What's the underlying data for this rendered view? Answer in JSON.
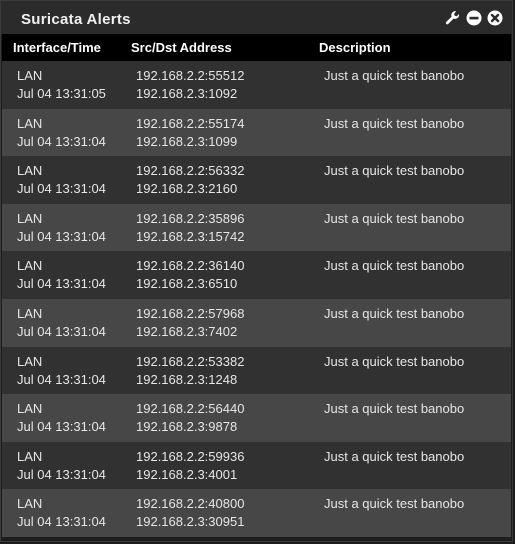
{
  "panel": {
    "title": "Suricata Alerts",
    "controls": [
      "wrench-icon",
      "minimize-icon",
      "close-icon"
    ]
  },
  "table": {
    "headers": [
      "Interface/Time",
      "Src/Dst Address",
      "Description"
    ],
    "rows": [
      {
        "iface": "LAN",
        "time": "Jul 04 13:31:05",
        "src": "192.168.2.2:55512",
        "dst": "192.168.2.3:1092",
        "desc": "Just a quick test banobo"
      },
      {
        "iface": "LAN",
        "time": "Jul 04 13:31:04",
        "src": "192.168.2.2:55174",
        "dst": "192.168.2.3:1099",
        "desc": "Just a quick test banobo"
      },
      {
        "iface": "LAN",
        "time": "Jul 04 13:31:04",
        "src": "192.168.2.2:56332",
        "dst": "192.168.2.3:2160",
        "desc": "Just a quick test banobo"
      },
      {
        "iface": "LAN",
        "time": "Jul 04 13:31:04",
        "src": "192.168.2.2:35896",
        "dst": "192.168.2.3:15742",
        "desc": "Just a quick test banobo"
      },
      {
        "iface": "LAN",
        "time": "Jul 04 13:31:04",
        "src": "192.168.2.2:36140",
        "dst": "192.168.2.3:6510",
        "desc": "Just a quick test banobo"
      },
      {
        "iface": "LAN",
        "time": "Jul 04 13:31:04",
        "src": "192.168.2.2:57968",
        "dst": "192.168.2.3:7402",
        "desc": "Just a quick test banobo"
      },
      {
        "iface": "LAN",
        "time": "Jul 04 13:31:04",
        "src": "192.168.2.2:53382",
        "dst": "192.168.2.3:1248",
        "desc": "Just a quick test banobo"
      },
      {
        "iface": "LAN",
        "time": "Jul 04 13:31:04",
        "src": "192.168.2.2:56440",
        "dst": "192.168.2.3:9878",
        "desc": "Just a quick test banobo"
      },
      {
        "iface": "LAN",
        "time": "Jul 04 13:31:04",
        "src": "192.168.2.2:59936",
        "dst": "192.168.2.3:4001",
        "desc": "Just a quick test banobo"
      },
      {
        "iface": "LAN",
        "time": "Jul 04 13:31:04",
        "src": "192.168.2.2:40800",
        "dst": "192.168.2.3:30951",
        "desc": "Just a quick test banobo"
      }
    ]
  },
  "colors": {
    "row_odd": "#313131",
    "row_even": "#474747",
    "header_bg": "#000000",
    "title_bar": "#2b2b2b"
  }
}
